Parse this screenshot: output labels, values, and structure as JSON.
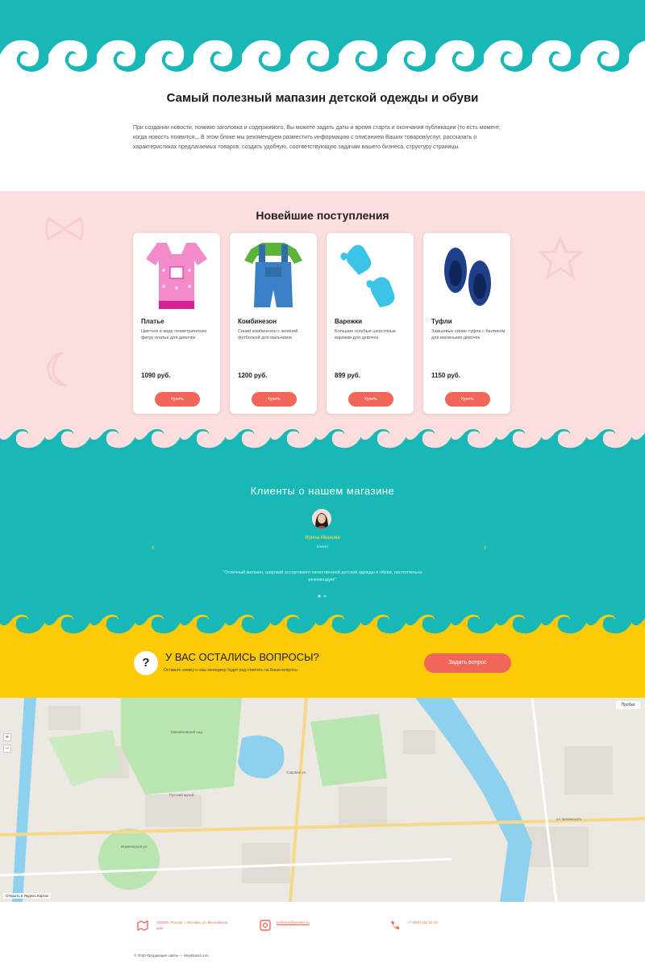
{
  "colors": {
    "teal": "#17b8b5",
    "pink": "#fcdede",
    "yellow": "#fdca08",
    "coral": "#f0675a"
  },
  "intro": {
    "title": "Самый полезный мапазин детской одежды и обуви",
    "text": "При создании новости, помимо заголовка и содержимого, Вы можете задать даты и время старта и окончания публикации (то есть момент, когда новость появится... В этом блоке мы рекомендуем разместить информацию с описанием Ваших товаров/услуг, рассказать о характеристиках предлагаемых товаров, создать удобную, соответствующую задачам вашего бизнеса, структуру страницы."
  },
  "arrivals": {
    "title": "Новейшие поступления",
    "buy_label": "Купить",
    "products": [
      {
        "name": "Платье",
        "desc": "Цветное в виде геометрических фигур платье для девочек",
        "price": "1090 руб.",
        "icon": "dress-icon"
      },
      {
        "name": "Комбинезон",
        "desc": "Синий комбинезон с зелёной футболкой для мальчиков",
        "price": "1200 руб.",
        "icon": "overalls-icon"
      },
      {
        "name": "Варежки",
        "desc": "Большие голубые шерстяные варежки для девочек",
        "price": "899 руб.",
        "icon": "mittens-icon"
      },
      {
        "name": "Туфли",
        "desc": "Замшевые синие туфли с бантиком для маленьких девочек",
        "price": "1150 руб.",
        "icon": "shoes-icon"
      }
    ]
  },
  "reviews": {
    "title": "Клиенты о нашем магазине",
    "name": "Ирина Иванова",
    "role": "Клиент",
    "text": "\"Отличный магазин, широкий ассортимент качественной детской одежды и обуви, настоятельно рекомендую!\"",
    "prev": "‹",
    "next": "›"
  },
  "questions": {
    "mark": "?",
    "title": "У ВАС ОСТАЛИСЬ ВОПРОСЫ?",
    "subtitle": "Оставьте заявку и наш менеджер будет рад ответить на Ваши вопросы",
    "button": "Задать вопрос"
  },
  "map": {
    "traffic": "Пробки",
    "yandex": "Открыть в Яндекс.Картах",
    "zoom_in": "+",
    "zoom_out": "−",
    "labels": [
      "Михайловский сад",
      "Русский музей",
      "Садовая ул.",
      "ул. Белинского",
      "Инженерная ул."
    ]
  },
  "footer": {
    "address": "190000, Россия, г. Москва, ул. Московская, дом",
    "email": "testform@yandex.ru",
    "phone": "+7 (000) 111-22-33",
    "copyright": "© 2020 Продающие сайты — WayBrand.com"
  }
}
